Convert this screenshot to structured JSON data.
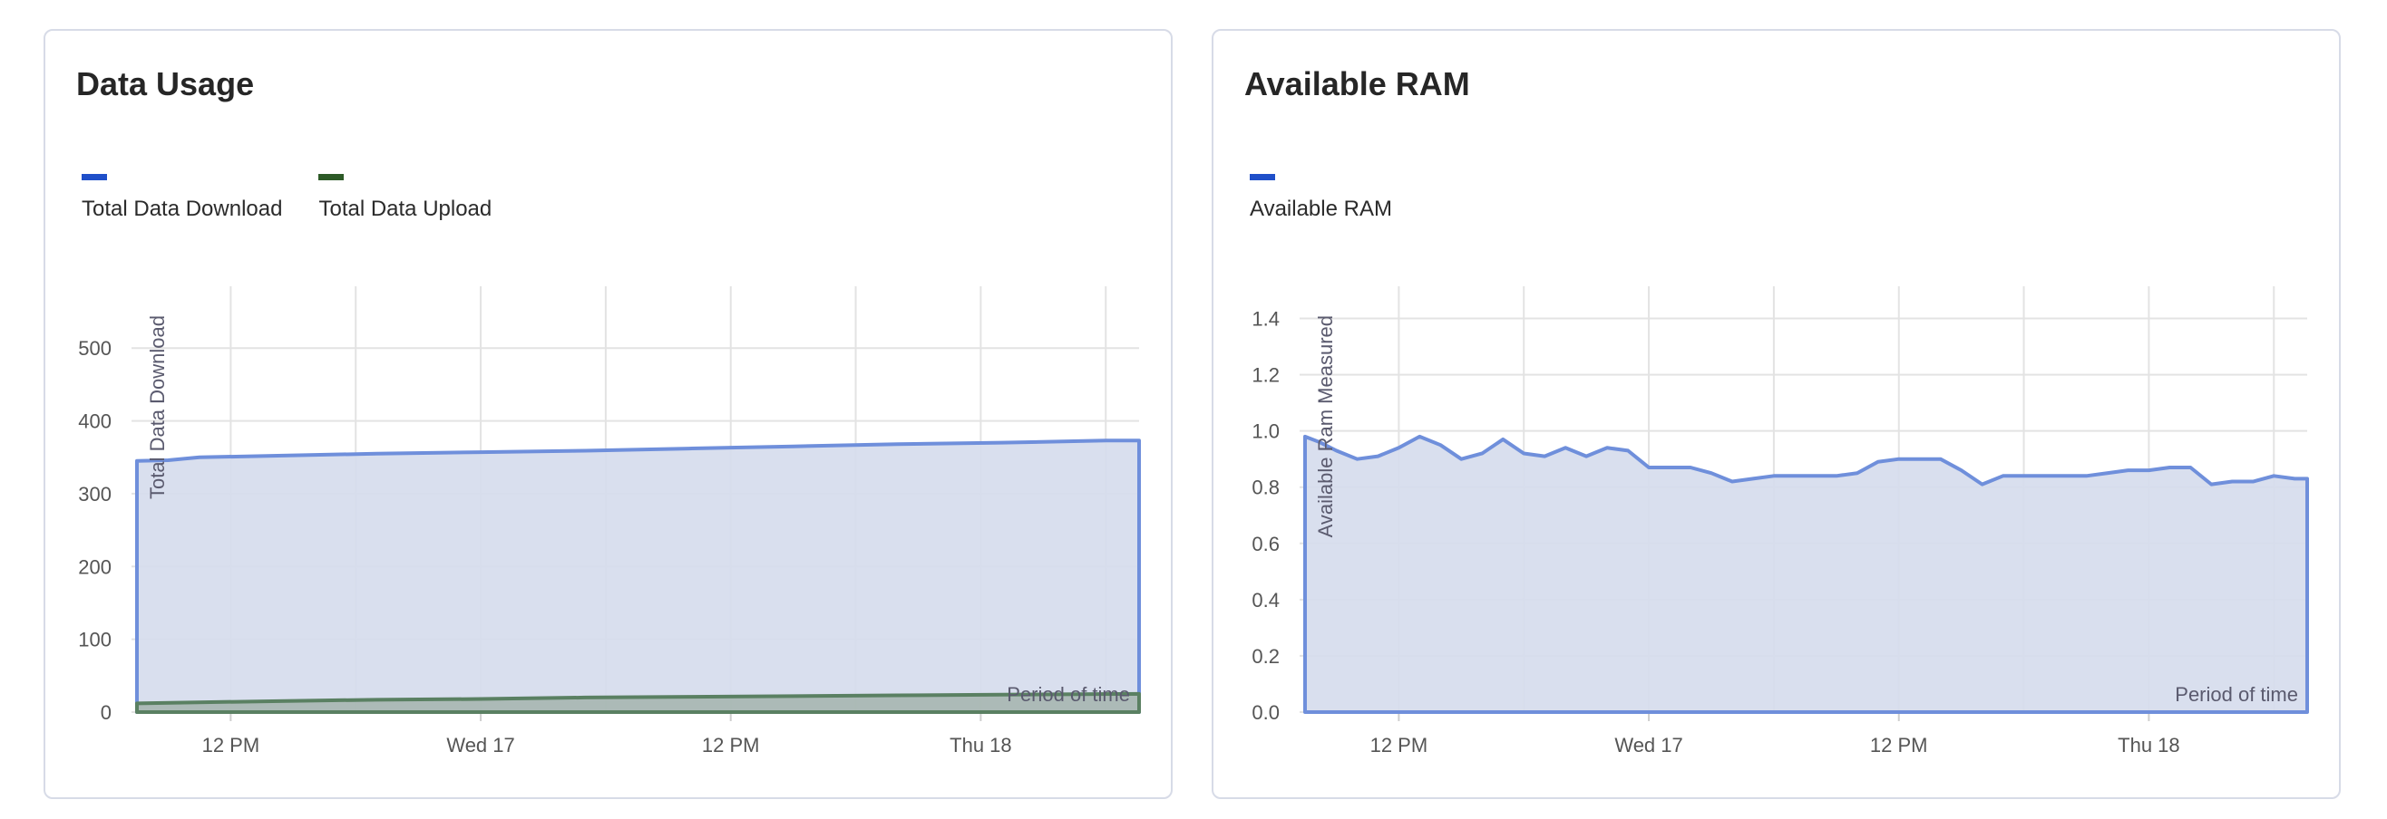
{
  "chart_data": [
    {
      "type": "area",
      "title": "Data Usage",
      "xlabel": "Period of time",
      "ylabel": "Total Data Download",
      "x_tick_labels": [
        "12 PM",
        "Wed 17",
        "12 PM",
        "Thu 18"
      ],
      "x_tick_positions": [
        3,
        15,
        27,
        39
      ],
      "xlim": [
        -1.5,
        46.6
      ],
      "ylim": [
        0,
        560
      ],
      "y_ticks": [
        0,
        100,
        200,
        300,
        400,
        500
      ],
      "grid": true,
      "legend": "top-left",
      "series": [
        {
          "name": "Total Data Download",
          "color": "#1f4fc9",
          "line_color": "#6f8fdb",
          "fill": "#d5dcec",
          "x": [
            -1.5,
            0,
            1.5,
            5,
            10,
            15,
            20,
            25,
            30,
            35,
            40,
            45,
            46.6
          ],
          "values": [
            345,
            346,
            350,
            352,
            355,
            357,
            359,
            362,
            365,
            368,
            370,
            373,
            373
          ]
        },
        {
          "name": "Total Data Upload",
          "color": "#2d5a27",
          "line_color": "#5a8062",
          "fill": "#a6b6b0",
          "x": [
            -1.5,
            5,
            10,
            15,
            20,
            25,
            30,
            35,
            40,
            46.6
          ],
          "values": [
            12,
            15,
            17,
            18,
            20,
            21,
            22,
            23,
            24,
            25
          ]
        }
      ]
    },
    {
      "type": "area",
      "title": "Available RAM",
      "xlabel": "Period of time",
      "ylabel": "Available Ram Measured",
      "x_tick_labels": [
        "12 PM",
        "Wed 17",
        "12 PM",
        "Thu 18"
      ],
      "x_tick_positions": [
        3,
        15,
        27,
        39
      ],
      "xlim": [
        -1.5,
        46.6
      ],
      "ylim": [
        0,
        1.45
      ],
      "y_ticks": [
        0.0,
        0.2,
        0.4,
        0.6,
        0.8,
        1.0,
        1.2,
        1.4
      ],
      "grid": true,
      "legend": "top-left",
      "series": [
        {
          "name": "Available RAM",
          "color": "#1f4fc9",
          "line_color": "#6f8fdb",
          "fill": "#d5dcec",
          "x": [
            -1.5,
            -0.8,
            0,
            1,
            2,
            3,
            4,
            5,
            6,
            7,
            8,
            9,
            10,
            11,
            12,
            13,
            14,
            15,
            16,
            17,
            18,
            19,
            20,
            21,
            22,
            23,
            24,
            25,
            26,
            27,
            28,
            29,
            30,
            31,
            32,
            33,
            34,
            35,
            36,
            37,
            38,
            39,
            40,
            41,
            42,
            43,
            44,
            45,
            46,
            46.6
          ],
          "values": [
            0.98,
            0.96,
            0.93,
            0.9,
            0.91,
            0.94,
            0.98,
            0.95,
            0.9,
            0.92,
            0.97,
            0.92,
            0.91,
            0.94,
            0.91,
            0.94,
            0.93,
            0.87,
            0.87,
            0.87,
            0.85,
            0.82,
            0.83,
            0.84,
            0.84,
            0.84,
            0.84,
            0.85,
            0.89,
            0.9,
            0.9,
            0.9,
            0.86,
            0.81,
            0.84,
            0.84,
            0.84,
            0.84,
            0.84,
            0.85,
            0.86,
            0.86,
            0.87,
            0.87,
            0.81,
            0.82,
            0.82,
            0.84,
            0.83,
            0.83
          ]
        }
      ]
    }
  ]
}
